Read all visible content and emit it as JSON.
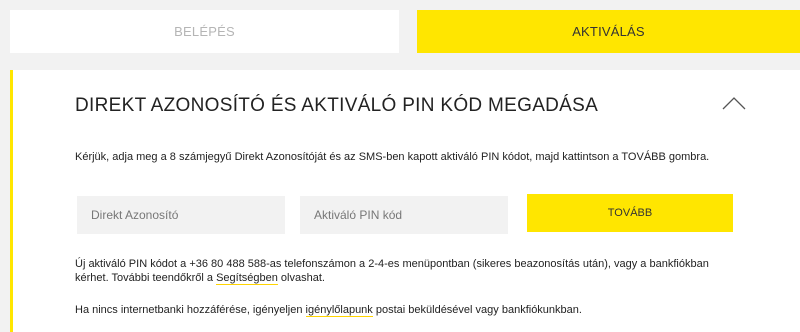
{
  "tabs": {
    "login_label": "BELÉPÉS",
    "activate_label": "AKTIVÁLÁS"
  },
  "panel": {
    "title": "DIREKT AZONOSÍTÓ ÉS AKTIVÁLÓ PIN KÓD MEGADÁSA",
    "collapse_icon": "chevron-up-icon",
    "instructions": "Kérjük, adja meg a 8 számjegyű Direkt Azonosítóját és az SMS-ben kapott aktiváló PIN kódot, majd kattintson a TOVÁBB gombra.",
    "id_placeholder": "Direkt Azonosító",
    "id_value": "",
    "pin_placeholder": "Aktiváló PIN kód",
    "pin_value": "",
    "next_label": "TOVÁBB",
    "info_before_link": "Új aktiváló PIN kódot a +36 80 488 588-as telefonszámon a 2-4-es menüpontban (sikeres beazonosítás után), vagy a bankfiókban kérhet. További teendőkről a ",
    "help_link": "Segítségben",
    "info_after_link": " olvashat.",
    "info2_before_link": "Ha nincs internetbanki hozzáférése, igényeljen ",
    "form_link": "igénylőlapunk",
    "info2_after_link": " postai beküldésével vagy bankfiókunkban."
  },
  "colors": {
    "accent": "#ffe600",
    "background": "#f2f2f2",
    "text": "#222222",
    "muted_tab_text": "#b5b5b5"
  }
}
